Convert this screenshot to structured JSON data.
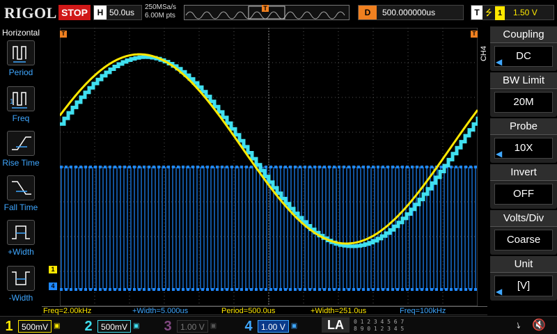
{
  "top": {
    "logo": "RIGOL",
    "run_state": "STOP",
    "horizontal_label": "H",
    "timebase": "50.0us",
    "sample_rate": "250MSa/s",
    "memory_points": "6.00M pts",
    "trigger_marker": "T",
    "delay_label": "D",
    "delay": "500.000000us",
    "trigger_label": "T",
    "trigger_edge": "⭍",
    "trigger_source": "1",
    "trigger_level": "1.50 V"
  },
  "left_menu": {
    "title": "Horizontal",
    "items": [
      {
        "label": "Period",
        "icon": "period-icon"
      },
      {
        "label": "Freq",
        "icon": "freq-icon"
      },
      {
        "label": "Rise Time",
        "icon": "rise-time-icon"
      },
      {
        "label": "Fall Time",
        "icon": "fall-time-icon"
      },
      {
        "label": "+Width",
        "icon": "pos-width-icon"
      },
      {
        "label": "-Width",
        "icon": "neg-width-icon"
      }
    ]
  },
  "right_menu": {
    "channel_tag": "CH4",
    "items": [
      {
        "title": "Coupling",
        "value": "DC"
      },
      {
        "title": "BW Limit",
        "value": "20M"
      },
      {
        "title": "Probe",
        "value": "10X"
      },
      {
        "title": "Invert",
        "value": "OFF"
      },
      {
        "title": "Volts/Div",
        "value": "Coarse"
      },
      {
        "title": "Unit",
        "value": "[V]"
      }
    ]
  },
  "waveform": {
    "ch1_marker": "1",
    "ch4_marker": "4",
    "trigger_level_marker": "T",
    "ch1_color": "#ffe800",
    "ch2_color": "#40e0f0",
    "ch4_color": "#1e88ff"
  },
  "measurements": [
    {
      "text": "Freq=2.00kHz",
      "color": "yellow"
    },
    {
      "text": "+Width=5.000us",
      "color": "blue"
    },
    {
      "text": "Period=500.0us",
      "color": "yellow"
    },
    {
      "text": "+Width=251.0us",
      "color": "yellow"
    },
    {
      "text": "Freq=100kHz",
      "color": "blue"
    }
  ],
  "channels": [
    {
      "num": "1",
      "scale": "500mV",
      "color": "#ffe800",
      "active": true
    },
    {
      "num": "2",
      "scale": "500mV",
      "color": "#40e0f0",
      "active": true
    },
    {
      "num": "3",
      "scale": "1.00 V",
      "color": "#c080c0",
      "active": false
    },
    {
      "num": "4",
      "scale": "1.00 V",
      "color": "#3fa7ff",
      "active": true
    }
  ],
  "la_label": "LA",
  "digital_row1": "0 1 2 3  4 5 6 7",
  "digital_row2": "8 9 0 1  2 3 4 5"
}
